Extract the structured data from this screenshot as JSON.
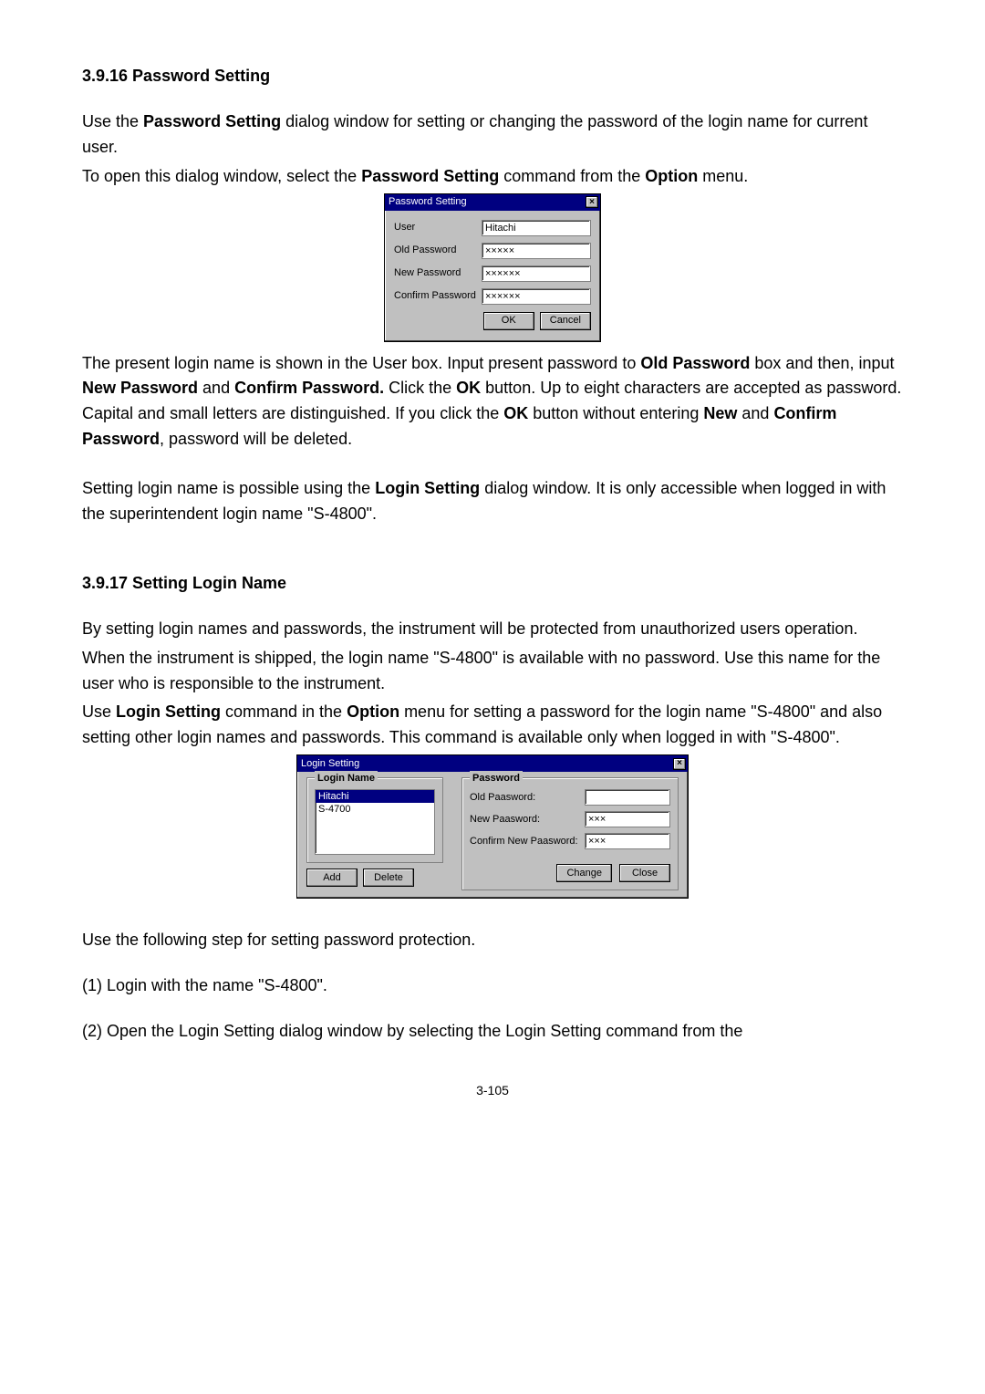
{
  "sec1": {
    "heading": "3.9.16   Password Setting",
    "p1a": "Use the ",
    "p1b": "Password Setting",
    "p1c": " dialog window for setting or changing the password of the login name for current user.",
    "p2a": "To open this dialog window, select the ",
    "p2b": "Password Setting",
    "p2c": " command from the ",
    "p2d": "Option",
    "p2e": " menu.",
    "dialog": {
      "title": "Password Setting",
      "close": "×",
      "user_label": "User",
      "user_value": "Hitachi",
      "old_label": "Old Password",
      "old_value": "×××××",
      "new_label": "New Password",
      "new_value": "××××××",
      "confirm_label": "Confirm Password",
      "confirm_value": "××××××",
      "ok": "OK",
      "cancel": "Cancel"
    },
    "p3a": "The present login name is shown in the User box. Input present password to ",
    "p3b": "Old Password",
    "p3c": " box and then, input ",
    "p3d": "New Password",
    "p3e": " and ",
    "p3f": "Confirm Password.",
    "p3g": " Click the ",
    "p3h": "OK",
    "p3i": " button. Up to eight characters are accepted as password. Capital and small letters are distinguished. If you click the ",
    "p3j": "OK",
    "p3k": " button without entering ",
    "p3l": "New",
    "p3m": " and ",
    "p3n": "Confirm Password",
    "p3o": ", password will be deleted.",
    "p4a": "Setting login name is possible using the ",
    "p4b": "Login Setting",
    "p4c": " dialog window. It is only accessible when logged in with the superintendent login name \"S-4800\"."
  },
  "sec2": {
    "heading": "3.9.17   Setting Login Name",
    "p1": "By setting login names and passwords, the instrument will be protected from unauthorized users operation.",
    "p2": "When the instrument is shipped, the login name \"S-4800\" is available with no password. Use this name for the user who is responsible to the instrument.",
    "p3a": "Use ",
    "p3b": "Login Setting",
    "p3c": " command in the ",
    "p3d": "Option",
    "p3e": " menu for setting a password for the login name \"S-4800\" and also setting other login names and passwords. This command is available only when logged in with \"S-4800\".",
    "dialog": {
      "title": "Login Setting",
      "close": "×",
      "loginname_legend": "Login Name",
      "list_item0": "Hitachi",
      "list_item1": "S-4700",
      "add": "Add",
      "delete": "Delete",
      "password_legend": "Password",
      "old_label": "Old Paasword:",
      "old_value": "",
      "new_label": "New Paasword:",
      "new_value": "×××",
      "confirm_label": "Confirm New Paasword:",
      "confirm_value": "×××",
      "change": "Change",
      "closebtn": "Close"
    },
    "p4": "Use the following step for setting password protection.",
    "step1": "(1) Login with the name \"S-4800\".",
    "step2": "(2)  Open  the  Login  Setting  dialog  window  by  selecting  the  Login  Setting  command  from  the"
  },
  "page_number": "3-105"
}
